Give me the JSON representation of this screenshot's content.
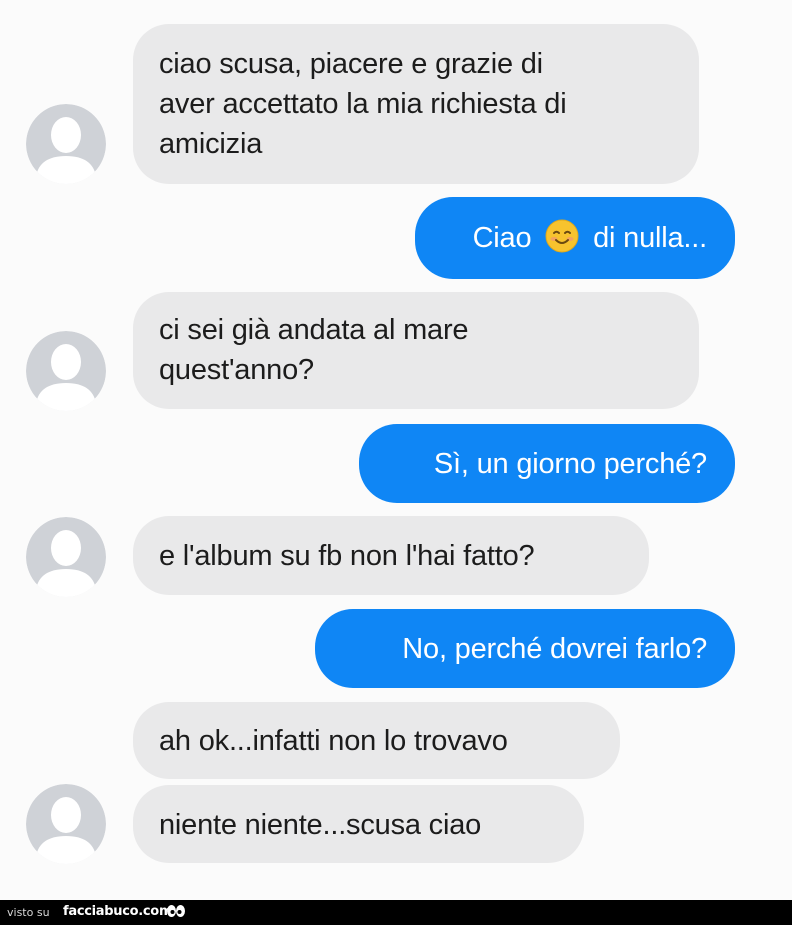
{
  "messages": [
    {
      "side": "incoming",
      "lines": [
        "ciao scusa, piacere e grazie di",
        "aver accettato la mia richiesta di",
        "amicizia"
      ]
    },
    {
      "side": "outgoing",
      "before_emoji": "Ciao",
      "emoji": "smiling-face-emoji",
      "after_emoji": "di nulla..."
    },
    {
      "side": "incoming",
      "lines": [
        "ci sei già andata al mare",
        "quest'anno?"
      ]
    },
    {
      "side": "outgoing",
      "text": "Sì, un giorno perché?"
    },
    {
      "side": "incoming",
      "text": "e l'album su fb non l'hai fatto?"
    },
    {
      "side": "outgoing",
      "text": "No, perché dovrei farlo?"
    },
    {
      "side": "incoming",
      "text": "ah ok...infatti non lo trovavo"
    },
    {
      "side": "incoming",
      "text": "niente niente...scusa ciao"
    }
  ],
  "footer": {
    "visto": "visto su",
    "brand": "facciabuco.com"
  },
  "colors": {
    "incoming_bubble": "#e9e9ea",
    "outgoing_bubble": "#0f86f5",
    "background": "#fbfbfb"
  },
  "icons": {
    "avatar": "default-profile-avatar-icon",
    "emoji": "smiling-face-emoji"
  }
}
